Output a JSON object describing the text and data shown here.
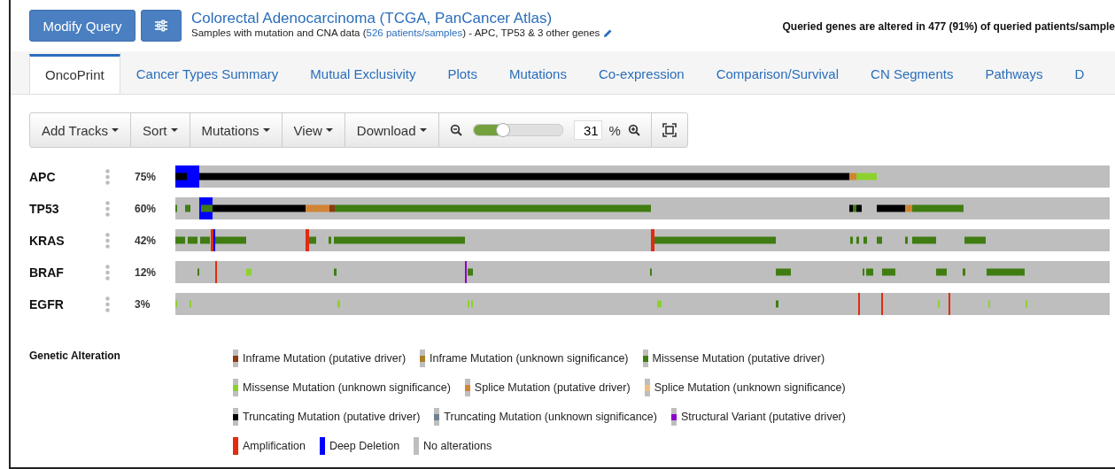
{
  "header": {
    "modify_button": "Modify Query",
    "title": "Colorectal Adenocarcinoma (TCGA, PanCancer Atlas)",
    "subtitle_prefix": "Samples with mutation and CNA data (",
    "subtitle_count": "526",
    "subtitle_link": "patients/samples",
    "subtitle_suffix": ")  - APC, TP53 & 3 other genes",
    "summary": "Queried genes are altered in 477 (91%) of queried patients/sample"
  },
  "tabs": [
    {
      "label": "OncoPrint",
      "selected": true
    },
    {
      "label": "Cancer Types Summary",
      "selected": false
    },
    {
      "label": "Mutual Exclusivity",
      "selected": false
    },
    {
      "label": "Plots",
      "selected": false
    },
    {
      "label": "Mutations",
      "selected": false
    },
    {
      "label": "Co-expression",
      "selected": false
    },
    {
      "label": "Comparison/Survival",
      "selected": false
    },
    {
      "label": "CN Segments",
      "selected": false
    },
    {
      "label": "Pathways",
      "selected": false
    },
    {
      "label": "D",
      "selected": false
    }
  ],
  "toolbar": {
    "menus": [
      "Add Tracks",
      "Sort",
      "Mutations",
      "View",
      "Download"
    ],
    "zoom": {
      "level": 0.33,
      "value": "31",
      "unit": "%"
    }
  },
  "genes": [
    {
      "name": "APC",
      "percent": "75%"
    },
    {
      "name": "TP53",
      "percent": "60%"
    },
    {
      "name": "KRAS",
      "percent": "42%"
    },
    {
      "name": "BRAF",
      "percent": "12%"
    },
    {
      "name": "EGFR",
      "percent": "3%"
    }
  ],
  "legend": {
    "title": "Genetic Alteration",
    "items": [
      {
        "label": "Inframe Mutation (putative driver)",
        "kind": "mutation",
        "color": "#8b3a12"
      },
      {
        "label": "Inframe Mutation (unknown significance)",
        "kind": "mutation",
        "color": "#a68028"
      },
      {
        "label": "Missense Mutation (putative driver)",
        "kind": "mutation",
        "color": "#3f7d12"
      },
      {
        "label": "Missense Mutation (unknown significance)",
        "kind": "mutation",
        "color": "#8cd12e"
      },
      {
        "label": "Splice Mutation (putative driver)",
        "kind": "mutation",
        "color": "#d08535"
      },
      {
        "label": "Splice Mutation (unknown significance)",
        "kind": "mutation",
        "color": "#f0c080"
      },
      {
        "label": "Truncating Mutation (putative driver)",
        "kind": "mutation",
        "color": "#000000"
      },
      {
        "label": "Truncating Mutation (unknown significance)",
        "kind": "mutation",
        "color": "#708090"
      },
      {
        "label": "Structural Variant (putative driver)",
        "kind": "mutation",
        "color": "#8b00c9"
      },
      {
        "label": "Amplification",
        "kind": "full",
        "color": "#e32b10"
      },
      {
        "label": "Deep Deletion",
        "kind": "full",
        "color": "#0000ff"
      },
      {
        "label": "No alterations",
        "kind": "full",
        "color": "#bebebe"
      }
    ]
  }
}
